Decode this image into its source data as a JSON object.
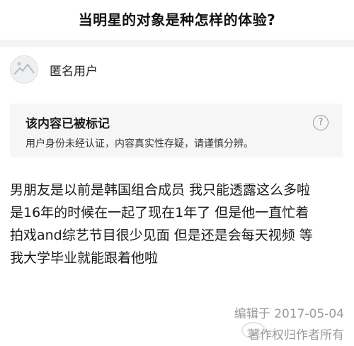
{
  "question": {
    "title": "当明星的对象是种怎样的体验?"
  },
  "author": {
    "name": "匿名用户",
    "avatar_icon": "anonymous-avatar-icon"
  },
  "flag_notice": {
    "title": "该内容已被标记",
    "description": "用户身份未经认证，内容真实性存疑，请谨慎分辨。",
    "help_icon": "question-mark-icon",
    "help_glyph": "?"
  },
  "answer": {
    "lines": [
      "男朋友是以前是韩国组合成员 我只能透露这么多啦",
      "是16年的时候在一起了现在1年了 但是他一直忙着",
      "拍戏and综艺节目很少见面 但是还是会每天视频 等",
      "我大学毕业就能跟着他啦"
    ]
  },
  "footer": {
    "edited": "编辑于 2017-05-04",
    "copyright": "著作权归作者所有"
  },
  "colors": {
    "background": "#ffffff",
    "divider": "#f3f4f6",
    "notice_background": "#f6f6f6",
    "meta_text": "#9a9a9a"
  }
}
